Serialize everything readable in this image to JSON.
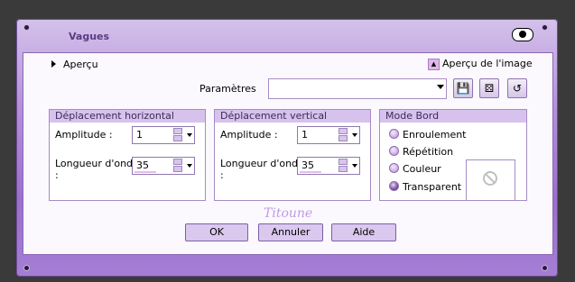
{
  "window": {
    "title": "Vagues"
  },
  "preview": {
    "label": "Aperçu",
    "image_label": "Aperçu de l'image"
  },
  "params": {
    "label": "Paramètres",
    "value": ""
  },
  "horizontal": {
    "title": "Déplacement horizontal",
    "amplitude_label": "Amplitude :",
    "amplitude": "1",
    "wavelength_label": "Longueur d'onde",
    "wavelength_colon": ":",
    "wavelength": "35"
  },
  "vertical": {
    "title": "Déplacement vertical",
    "amplitude_label": "Amplitude :",
    "amplitude": "1",
    "wavelength_label": "Longueur d'onde",
    "wavelength_colon": ":",
    "wavelength": "35"
  },
  "edge_mode": {
    "title": "Mode Bord",
    "options": [
      "Enroulement",
      "Répétition",
      "Couleur",
      "Transparent"
    ],
    "selected": "Transparent"
  },
  "signature": "Titoune",
  "buttons": {
    "ok": "OK",
    "cancel": "Annuler",
    "help": "Aide"
  }
}
